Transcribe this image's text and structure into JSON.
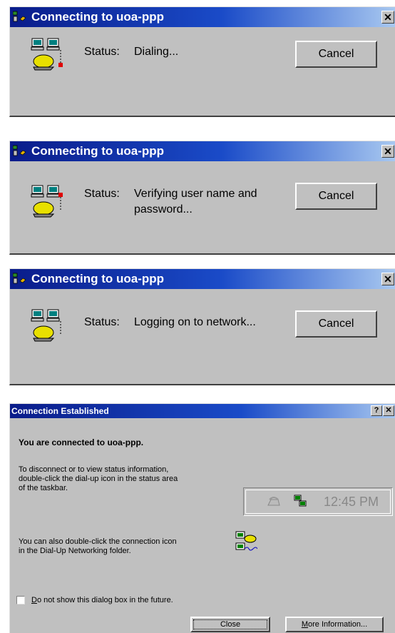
{
  "dialogs": [
    {
      "title": "Connecting to uoa-ppp",
      "status_label": "Status:",
      "status_value": "Dialing...",
      "cancel_label": "Cancel"
    },
    {
      "title": "Connecting to uoa-ppp",
      "status_label": "Status:",
      "status_value": "Verifying user name and password...",
      "cancel_label": "Cancel"
    },
    {
      "title": "Connecting to uoa-ppp",
      "status_label": "Status:",
      "status_value": "Logging on to network...",
      "cancel_label": "Cancel"
    }
  ],
  "established": {
    "title": "Connection Established",
    "help_label": "?",
    "close_x": "✕",
    "heading": "You are connected to uoa-ppp.",
    "para1": [
      "To disconnect or to view status information,",
      "double-click the dial-up icon in the status area",
      "of the taskbar."
    ],
    "clock": "12:45 PM",
    "para2": [
      "You can also double-click the connection icon",
      "in the Dial-Up Networking folder."
    ],
    "checkbox_prefix": "D",
    "checkbox_rest": "o not show this dialog box in the future.",
    "close_label": "Close",
    "more_prefix": "M",
    "more_rest": "ore Information..."
  },
  "icons": {
    "title": "dialup-title-icon",
    "status": "dialup-phone-computers-icon",
    "tray_phone": "tray-phone-icon",
    "tray_network": "tray-network-icon",
    "connection": "connection-icon"
  },
  "colors": {
    "titlebar_start": "#0a1c8a",
    "titlebar_end": "#a8c8f0",
    "face": "#c0c0c0"
  }
}
